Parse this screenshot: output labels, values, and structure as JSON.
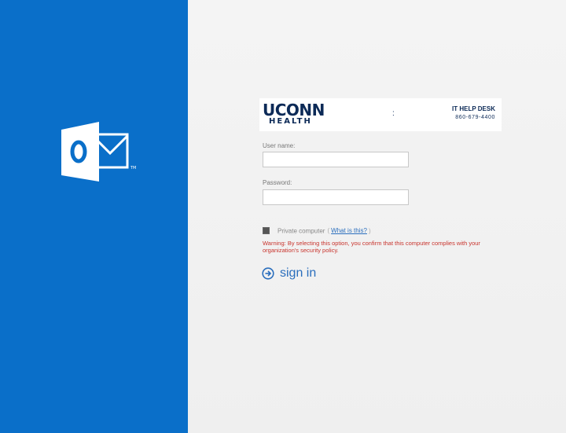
{
  "colors": {
    "left_panel": "#0a6fc9",
    "right_panel": "#f2f2f2",
    "brand_navy": "#0c2a57",
    "link_blue": "#2a6ebd",
    "warning_red": "#c8332c"
  },
  "logo": {
    "icon": "outlook-icon"
  },
  "banner": {
    "brand_line1": "UCONN",
    "brand_line2": "HEALTH",
    "divider": ":",
    "help_desk_title": "IT HELP DESK",
    "help_desk_phone": "860-679-4400"
  },
  "form": {
    "username_label": "User name:",
    "username_value": "",
    "password_label": "Password:",
    "password_value": "",
    "private_computer_label": "Private computer",
    "private_computer_checked": true,
    "bracket_open": "(",
    "what_is_this_link": "What is this?",
    "bracket_close": ")",
    "warning_text": "Warning: By selecting this option, you confirm that this computer complies with your organization's security policy.",
    "signin_label": "sign in",
    "signin_icon": "arrow-circle-right-icon"
  }
}
